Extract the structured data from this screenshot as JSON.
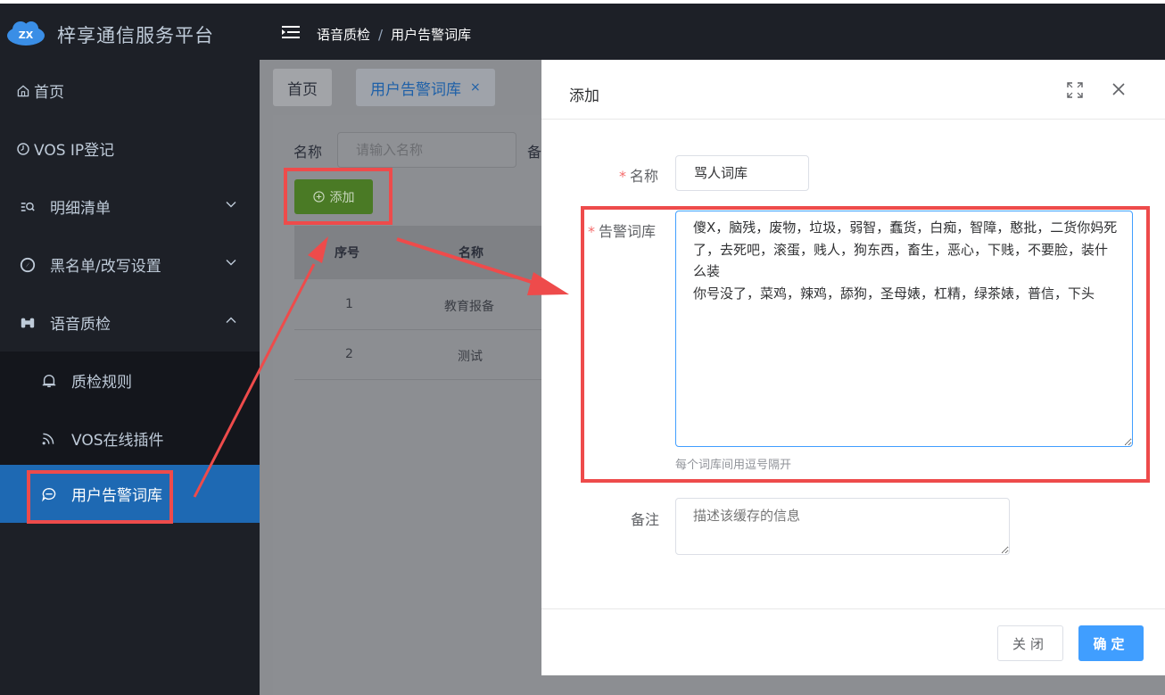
{
  "header": {
    "logo_text": "ZX",
    "title": "梓享通信服务平台",
    "breadcrumb": [
      "语音质检",
      "用户告警词库"
    ],
    "breadcrumb_sep": "/"
  },
  "sidebar": {
    "items": [
      {
        "label": "首页",
        "icon": "home-icon"
      },
      {
        "label": "VOS IP登记",
        "icon": "clock-icon"
      },
      {
        "label": "明细清单",
        "icon": "list-search-icon",
        "expandable": true
      },
      {
        "label": "黑名单/改写设置",
        "icon": "compass-icon",
        "expandable": true
      },
      {
        "label": "语音质检",
        "icon": "binoculars-icon",
        "expandable": true,
        "expanded": true
      },
      {
        "label": "质检规则",
        "icon": "bell-icon",
        "sub": true
      },
      {
        "label": "VOS在线插件",
        "icon": "rss-icon",
        "sub": true
      },
      {
        "label": "用户告警词库",
        "icon": "chat-icon",
        "sub": true,
        "active": true
      }
    ]
  },
  "tabs": [
    {
      "label": "首页"
    },
    {
      "label": "用户告警词库",
      "close": "×",
      "active": true
    }
  ],
  "filter": {
    "name_label": "名称",
    "name_placeholder": "请输入名称",
    "remark_label": "备"
  },
  "toolbar": {
    "add_label": "添加",
    "add_icon": "plus-circle-icon"
  },
  "table": {
    "headers": [
      "序号",
      "名称"
    ],
    "rows": [
      {
        "index": "1",
        "name": "教育报备"
      },
      {
        "index": "2",
        "name": "测试"
      }
    ]
  },
  "dialog": {
    "title": "添加",
    "name_label": "名称",
    "name_value": "骂人词库",
    "words_label": "告警词库",
    "words_value": "傻X，脑残，废物，垃圾，弱智，蠢货，白痴，智障，憨批，二货你妈死了，去死吧，滚蛋，贱人，狗东西，畜生，恶心，下贱，不要脸，装什么装\n你号没了，菜鸡，辣鸡，舔狗，圣母婊，杠精，绿茶婊，普信，下头",
    "words_hint": "每个词库间用逗号隔开",
    "remark_label": "备注",
    "remark_placeholder": "描述该缓存的信息",
    "required_mark": "*",
    "close_label": "关闭",
    "ok_label": "确定"
  },
  "colors": {
    "sidebar_bg": "#1d2027",
    "active_item": "#1e69b3",
    "primary": "#409eff",
    "annotation": "#ee4b4b",
    "add_button": "#4a7a25"
  }
}
